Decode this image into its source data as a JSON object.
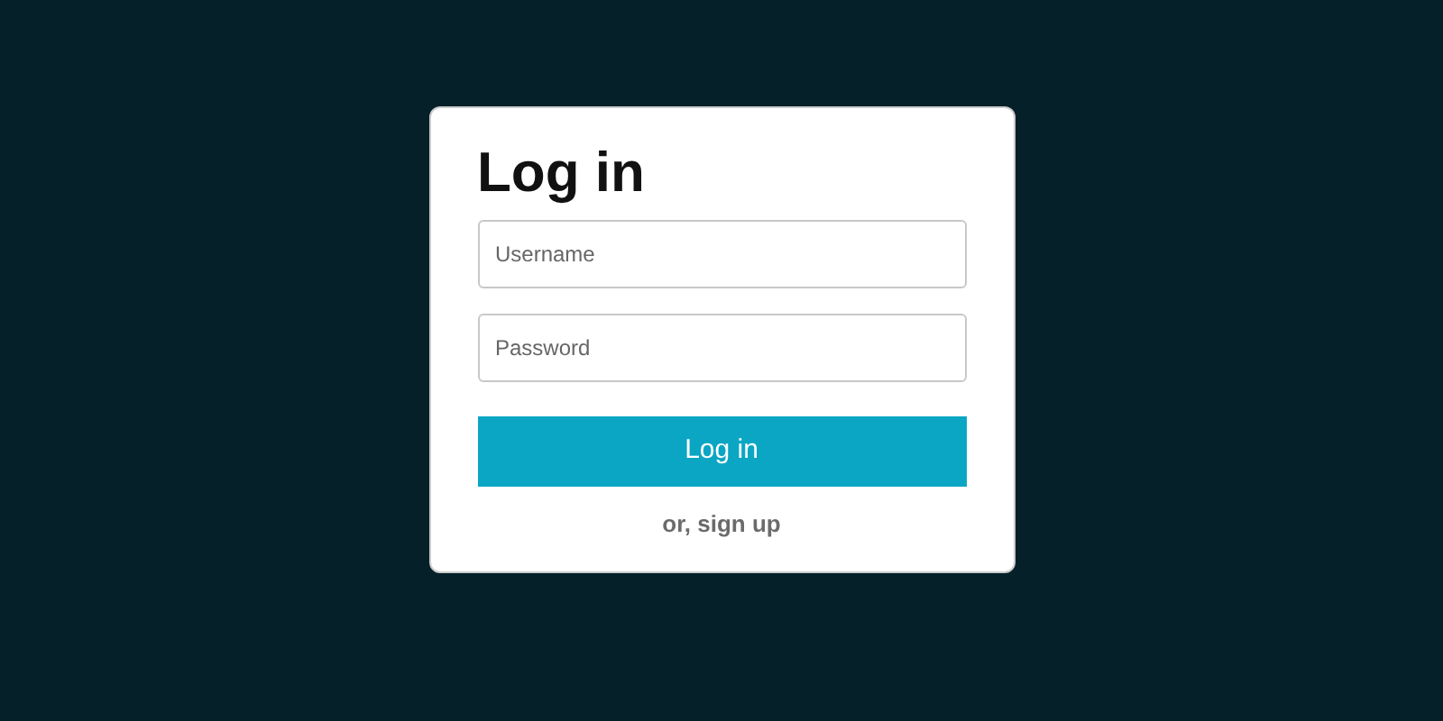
{
  "title": "Log in",
  "fields": [
    {
      "placeholder": "Username"
    },
    {
      "placeholder": "Password"
    }
  ],
  "submit": "Log in",
  "signup_link": "or, sign up"
}
